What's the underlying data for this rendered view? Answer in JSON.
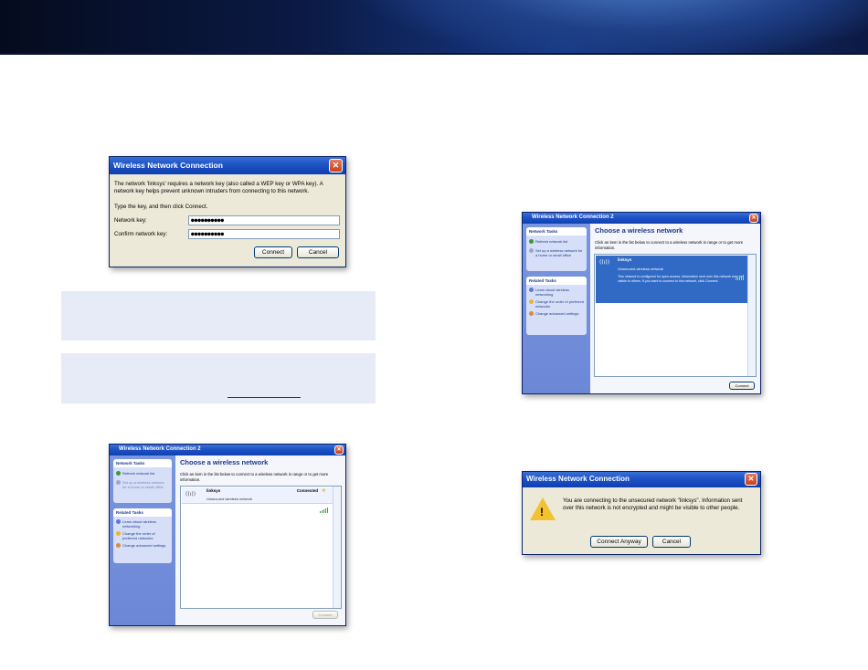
{
  "dialog_key": {
    "title": "Wireless Network Connection",
    "message": "The network 'linksys' requires a network key (also called a WEP key or WPA key). A network key helps prevent unknown intruders from connecting to this network.",
    "instruction": "Type the key, and then click Connect.",
    "network_key_label": "Network key:",
    "network_key_value": "●●●●●●●●●●",
    "confirm_key_label": "Confirm network key:",
    "confirm_key_value": "●●●●●●●●●●",
    "connect_label": "Connect",
    "cancel_label": "Cancel"
  },
  "choose_connected": {
    "title": "Wireless Network Connection 2",
    "heading": "Choose a wireless network",
    "hint": "Click an item in the list below to connect to a wireless network in range or to get more information.",
    "network_tasks_header": "Network Tasks",
    "refresh_label": "Refresh network list",
    "setup_label": "Set up a wireless network for a home or small office",
    "related_tasks_header": "Related Tasks",
    "learn_label": "Learn about wireless networking",
    "change_order_label": "Change the order of preferred networks",
    "advanced_label": "Change advanced settings",
    "network_name": "linksys",
    "network_status": "Connected",
    "network_security": "Unsecured wireless network",
    "connect_label": "Connect"
  },
  "choose_selected": {
    "title": "Wireless Network Connection 2",
    "heading": "Choose a wireless network",
    "hint": "Click an item in the list below to connect to a wireless network in range or to get more information.",
    "network_tasks_header": "Network Tasks",
    "refresh_label": "Refresh network list",
    "setup_label": "Set up a wireless network for a home or small office",
    "related_tasks_header": "Related Tasks",
    "learn_label": "Learn about wireless networking",
    "change_order_label": "Change the order of preferred networks",
    "advanced_label": "Change advanced settings",
    "network_name": "linksys",
    "network_security": "Unsecured wireless network",
    "network_detail": "This network is configured for open access. Information sent over this network may be visible to others. If you want to connect to this network, click Connect.",
    "connect_label": "Connect"
  },
  "dialog_unsecured": {
    "title": "Wireless Network Connection",
    "message": "You are connecting to the unsecured network \"linksys\". Information sent over this network is not encrypted and might be visible to other people.",
    "connect_anyway_label": "Connect Anyway",
    "cancel_label": "Cancel"
  },
  "colors": {
    "titlebar": "#1f55c8",
    "dialog_bg": "#ece9d8",
    "sidebar": "#6c87d6",
    "selection": "#316ac5",
    "note_bg": "#e7ebf7"
  }
}
